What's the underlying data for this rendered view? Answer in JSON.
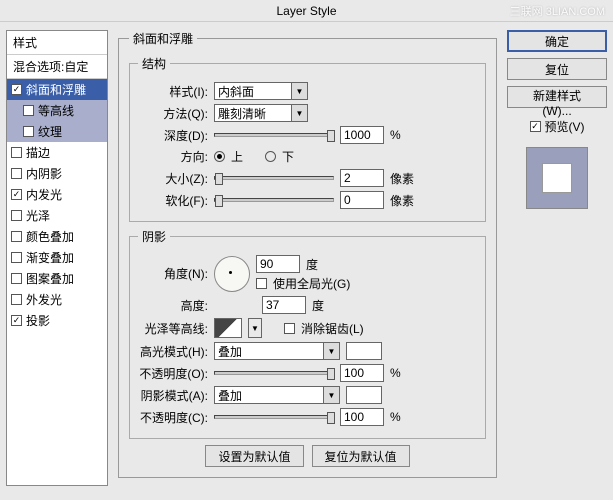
{
  "title": "Layer Style",
  "watermark": "三联网 3LIAN.COM",
  "left": {
    "header": "样式",
    "subheader": "混合选项:自定",
    "items": [
      {
        "label": "斜面和浮雕",
        "checked": true,
        "selected": true,
        "sub": false
      },
      {
        "label": "等高线",
        "checked": false,
        "selected": false,
        "sub": true
      },
      {
        "label": "纹理",
        "checked": false,
        "selected": false,
        "sub": true
      },
      {
        "label": "描边",
        "checked": false,
        "selected": false,
        "sub": false
      },
      {
        "label": "内阴影",
        "checked": false,
        "selected": false,
        "sub": false
      },
      {
        "label": "内发光",
        "checked": true,
        "selected": false,
        "sub": false
      },
      {
        "label": "光泽",
        "checked": false,
        "selected": false,
        "sub": false
      },
      {
        "label": "颜色叠加",
        "checked": false,
        "selected": false,
        "sub": false
      },
      {
        "label": "渐变叠加",
        "checked": false,
        "selected": false,
        "sub": false
      },
      {
        "label": "图案叠加",
        "checked": false,
        "selected": false,
        "sub": false
      },
      {
        "label": "外发光",
        "checked": false,
        "selected": false,
        "sub": false
      },
      {
        "label": "投影",
        "checked": true,
        "selected": false,
        "sub": false
      }
    ]
  },
  "center": {
    "group_title": "斜面和浮雕",
    "structure": {
      "legend": "结构",
      "style_label": "样式(I):",
      "style_value": "内斜面",
      "method_label": "方法(Q):",
      "method_value": "雕刻清晰",
      "depth_label": "深度(D):",
      "depth_value": "1000",
      "depth_unit": "%",
      "direction_label": "方向:",
      "up": "上",
      "down": "下",
      "size_label": "大小(Z):",
      "size_value": "2",
      "size_unit": "像素",
      "soften_label": "软化(F):",
      "soften_value": "0",
      "soften_unit": "像素"
    },
    "shading": {
      "legend": "阴影",
      "angle_label": "角度(N):",
      "angle_value": "90",
      "angle_unit": "度",
      "global_label": "使用全局光(G)",
      "altitude_label": "高度:",
      "altitude_value": "37",
      "altitude_unit": "度",
      "contour_label": "光泽等高线:",
      "aa_label": "消除锯齿(L)",
      "hmode_label": "高光模式(H):",
      "hmode_value": "叠加",
      "hopacity_label": "不透明度(O):",
      "hopacity_value": "100",
      "hopacity_unit": "%",
      "smode_label": "阴影模式(A):",
      "smode_value": "叠加",
      "sopacity_label": "不透明度(C):",
      "sopacity_value": "100",
      "sopacity_unit": "%"
    },
    "make_default": "设置为默认值",
    "reset_default": "复位为默认值"
  },
  "right": {
    "ok": "确定",
    "cancel": "复位",
    "new_style": "新建样式(W)...",
    "preview": "预览(V)"
  }
}
